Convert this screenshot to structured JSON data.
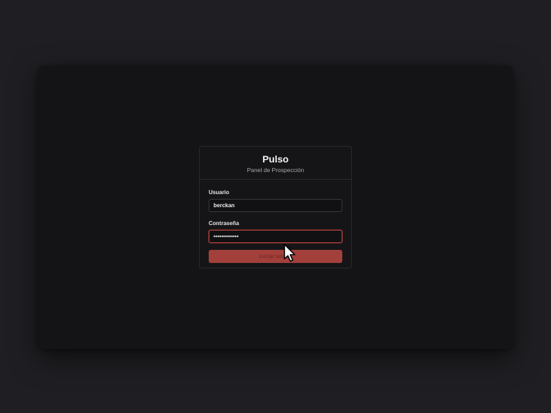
{
  "app": {
    "title": "Pulso",
    "subtitle": "Panel de Prospección"
  },
  "form": {
    "username_label": "Usuario",
    "username_value": "berckan",
    "password_label": "Contraseña",
    "password_value": "•••••••••••••",
    "submit_label": "Iniciar sesión"
  },
  "colors": {
    "accent": "#a3403b",
    "focus_border": "#c2423e",
    "card_background": "#151518",
    "window_background": "#141417",
    "page_background": "#1f1f23"
  },
  "icons": {
    "cursor": "arrow-pointer"
  }
}
